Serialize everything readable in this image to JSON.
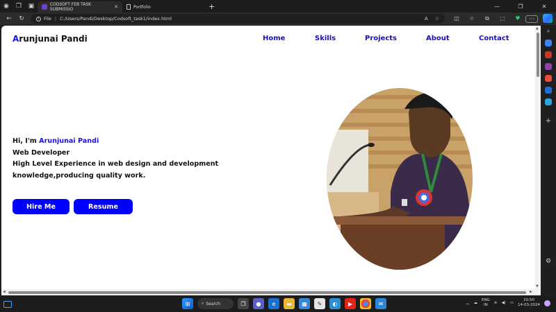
{
  "browser": {
    "tabs": [
      {
        "label": "CODSOFT FEB TASK SUBMISSIO",
        "active": true
      },
      {
        "label": "Portfolio",
        "active": false
      }
    ],
    "address": {
      "scheme_label": "File",
      "url": "C:/Users/Pandi/Desktop/Codsoft_task1/index.html"
    }
  },
  "site": {
    "logo_first": "A",
    "logo_rest": "runjunai Pandi",
    "nav": [
      "Home",
      "Skills",
      "Projects",
      "About",
      "Contact"
    ],
    "intro": {
      "greeting": "Hi, I'm ",
      "name": "Arunjunai Pandi",
      "role": "Web Developer",
      "line3": "High Level Experience in web design and development",
      "line4": "knowledge,producing quality work."
    },
    "buttons": {
      "hire": "Hire Me",
      "resume": "Resume"
    }
  },
  "taskbar": {
    "search_label": "Search",
    "lang_top": "ENG",
    "lang_bottom": "IN",
    "time": "20:50",
    "date": "14-03-2024"
  },
  "colors": {
    "accent": "#1a0dff",
    "button": "#0000ff",
    "nav": "#1a0dbd"
  }
}
